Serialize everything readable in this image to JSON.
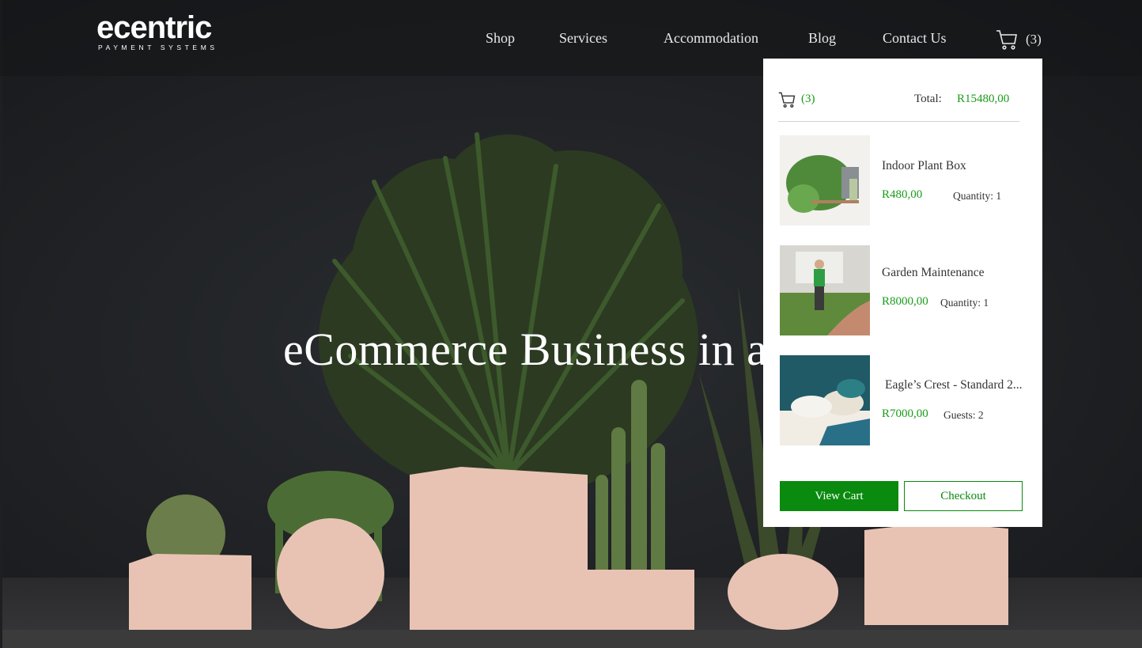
{
  "brand": {
    "name": "ecentric",
    "tagline": "PAYMENT SYSTEMS"
  },
  "nav": {
    "items": [
      {
        "label": "Shop"
      },
      {
        "label": "Services"
      },
      {
        "label": "Accommodation"
      },
      {
        "label": "Blog"
      },
      {
        "label": "Contact Us"
      }
    ],
    "cart_count": "(3)"
  },
  "hero": {
    "title": "eCommerce Business in a"
  },
  "cart": {
    "count": "(3)",
    "total_label": "Total:",
    "total_value": "R15480,00",
    "items": [
      {
        "name": "Indoor Plant Box",
        "price": "R480,00",
        "detail": "Quantity: 1"
      },
      {
        "name": "Garden Maintenance",
        "price": "R8000,00",
        "detail": "Quantity: 1"
      },
      {
        "name": "Eagle’s Crest - Standard 2...",
        "price": "R7000,00",
        "detail": "Guests: 2"
      }
    ],
    "view_cart_label": "View Cart",
    "checkout_label": "Checkout"
  },
  "colors": {
    "accent_green": "#0a8a0f",
    "price_green": "#1a9b1a",
    "header_bg": "#1e1f22"
  }
}
